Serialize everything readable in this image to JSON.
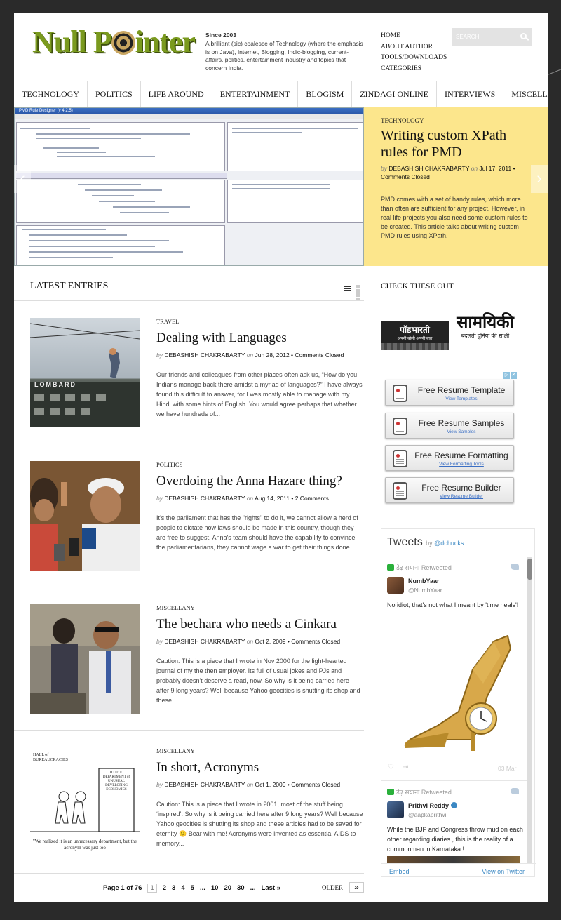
{
  "header": {
    "logo_text_1": "Null P",
    "logo_text_2": "inter",
    "since": "Since 2003",
    "tagline": "A brilliant (sic) coalesce of Technology (where the emphasis is on Java), Internet, Blogging, Indic-blogging, current-affairs, politics, entertainment industry and topics that concern India.",
    "top_links": [
      "HOME",
      "ABOUT AUTHOR",
      "TOOLS/DOWNLOADS",
      "CATEGORIES"
    ],
    "search_placeholder": "SEARCH"
  },
  "nav": [
    "TECHNOLOGY",
    "POLITICS",
    "LIFE AROUND",
    "ENTERTAINMENT",
    "BLOGISM",
    "ZINDAGI ONLINE",
    "INTERVIEWS",
    "MISCELLANY"
  ],
  "featured": {
    "screenshot_title": "PMD Rule Designer (v 4.2.5)",
    "category": "TECHNOLOGY",
    "title": "Writing custom XPath rules for PMD",
    "author": "DEBASHISH CHAKRABARTY",
    "on": "on",
    "date": "Jul 17, 2011",
    "comments": "Comments Closed",
    "excerpt": "PMD comes with a set of handy rules, which more than often are sufficient for any project. However, in real life projects you also need some custom rules to be created. This article talks about writing custom PMD rules using XPath.",
    "prev": "‹",
    "next": "›"
  },
  "latest": {
    "heading": "LATEST ENTRIES",
    "entries": [
      {
        "category": "TRAVEL",
        "title": "Dealing with Languages",
        "by": "by",
        "author": "DEBASHISH CHAKRABARTY",
        "on": "on",
        "date": "Jun 28, 2012",
        "comments": "Comments Closed",
        "excerpt": "Our friends and colleagues from other places often ask us, “How do you Indians manage back there amidst a myriad of languages?” I have always found this difficult to answer, for I was mostly able to manage with my Hindi with some hints of English. You would agree perhaps that whether we have hundreds of...",
        "thumb_text": "LOMBARD"
      },
      {
        "category": "POLITICS",
        "title": "Overdoing the Anna Hazare thing?",
        "by": "by",
        "author": "DEBASHISH CHAKRABARTY",
        "on": "on",
        "date": "Aug 14, 2011",
        "comments": "2 Comments",
        "excerpt": "It's the parliament that has the \"rights\" to do it, we cannot allow a herd of people to dictate how laws should be made in this country, though they are free to suggest. Anna's team should have the capability to convince the parliamentarians, they cannot wage a war to get their things done."
      },
      {
        "category": "MISCELLANY",
        "title": "The bechara who needs a Cinkara",
        "by": "by",
        "author": "DEBASHISH CHAKRABARTY",
        "on": "on",
        "date": "Oct 2, 2009",
        "comments": "Comments Closed",
        "excerpt": "Caution: This is a piece that I wrote in Nov 2000 for the light-hearted journal of my the then employer. Its full of usual jokes and PJs and probably doesn't deserve a read, now. So why is it being carried here after 9 long years? Well because Yahoo geocities is shutting its shop and these..."
      },
      {
        "category": "MISCELLANY",
        "title": "In short, Acronyms",
        "by": "by",
        "author": "DEBASHISH CHAKRABARTY",
        "on": "on",
        "date": "Oct 1, 2009",
        "comments": "Comments Closed",
        "excerpt": "Caution: This is a piece that I wrote in 2001, most of the stuff being ‘inspired’. So why is it being carried here after 9 long years? Well because Yahoo geocities is shutting its shop and these articles had to be saved for eternity 🙂 Bear with me! Acronyms were invented as essential AIDS to memory...",
        "cartoon_top": "HALL of BUREAUCRACIES",
        "cartoon_door": "D.U.D.E. DEPARTMENT of UNUSUAL DEVELOPING ECONOMICS",
        "cartoon_caption": "\"We realized it is an unnecessary department, but the acronym was just too"
      }
    ]
  },
  "pagination": {
    "label": "Page 1 of 76",
    "current": "1",
    "pages": [
      "2",
      "3",
      "4",
      "5",
      "...",
      "10",
      "20",
      "30",
      "...",
      "Last »"
    ],
    "older": "OLDER",
    "older_icon": "»"
  },
  "sidebar": {
    "heading": "CHECK THESE OUT",
    "banner1_title": "पॉडभारती",
    "banner1_sub": "अपनी बोली अपनी बात",
    "banner2_title": "सामयिकी",
    "banner2_sub": "बदलती दुनिया की साक्षी",
    "ad_buttons": [
      {
        "label": "Free Resume Template",
        "sub": "View Templates"
      },
      {
        "label": "Free Resume Samples",
        "sub": "View Samples"
      },
      {
        "label": "Free Resume Formatting",
        "sub": "View Formatting Tools"
      },
      {
        "label": "Free Resume Builder",
        "sub": "View Resume Builder"
      }
    ]
  },
  "tweets": {
    "title": "Tweets",
    "by": "by",
    "handle": "@dchucks",
    "items": [
      {
        "retweeted": "डेढ़ सयाना Retweeted",
        "name": "NumbYaar",
        "handle": "@NumbYaar",
        "text": "No idiot, that's not what I meant by 'time heals'!",
        "date": "03 Mar"
      },
      {
        "retweeted": "डेढ़ सयाना Retweeted",
        "name": "Prithvi Reddy",
        "handle": "@aapkaprithvi",
        "text": "While the BJP and Congress throw mud on each other regarding diaries , this is the reality of a  commonman in Karnataka !"
      }
    ],
    "embed": "Embed",
    "view": "View on Twitter"
  }
}
